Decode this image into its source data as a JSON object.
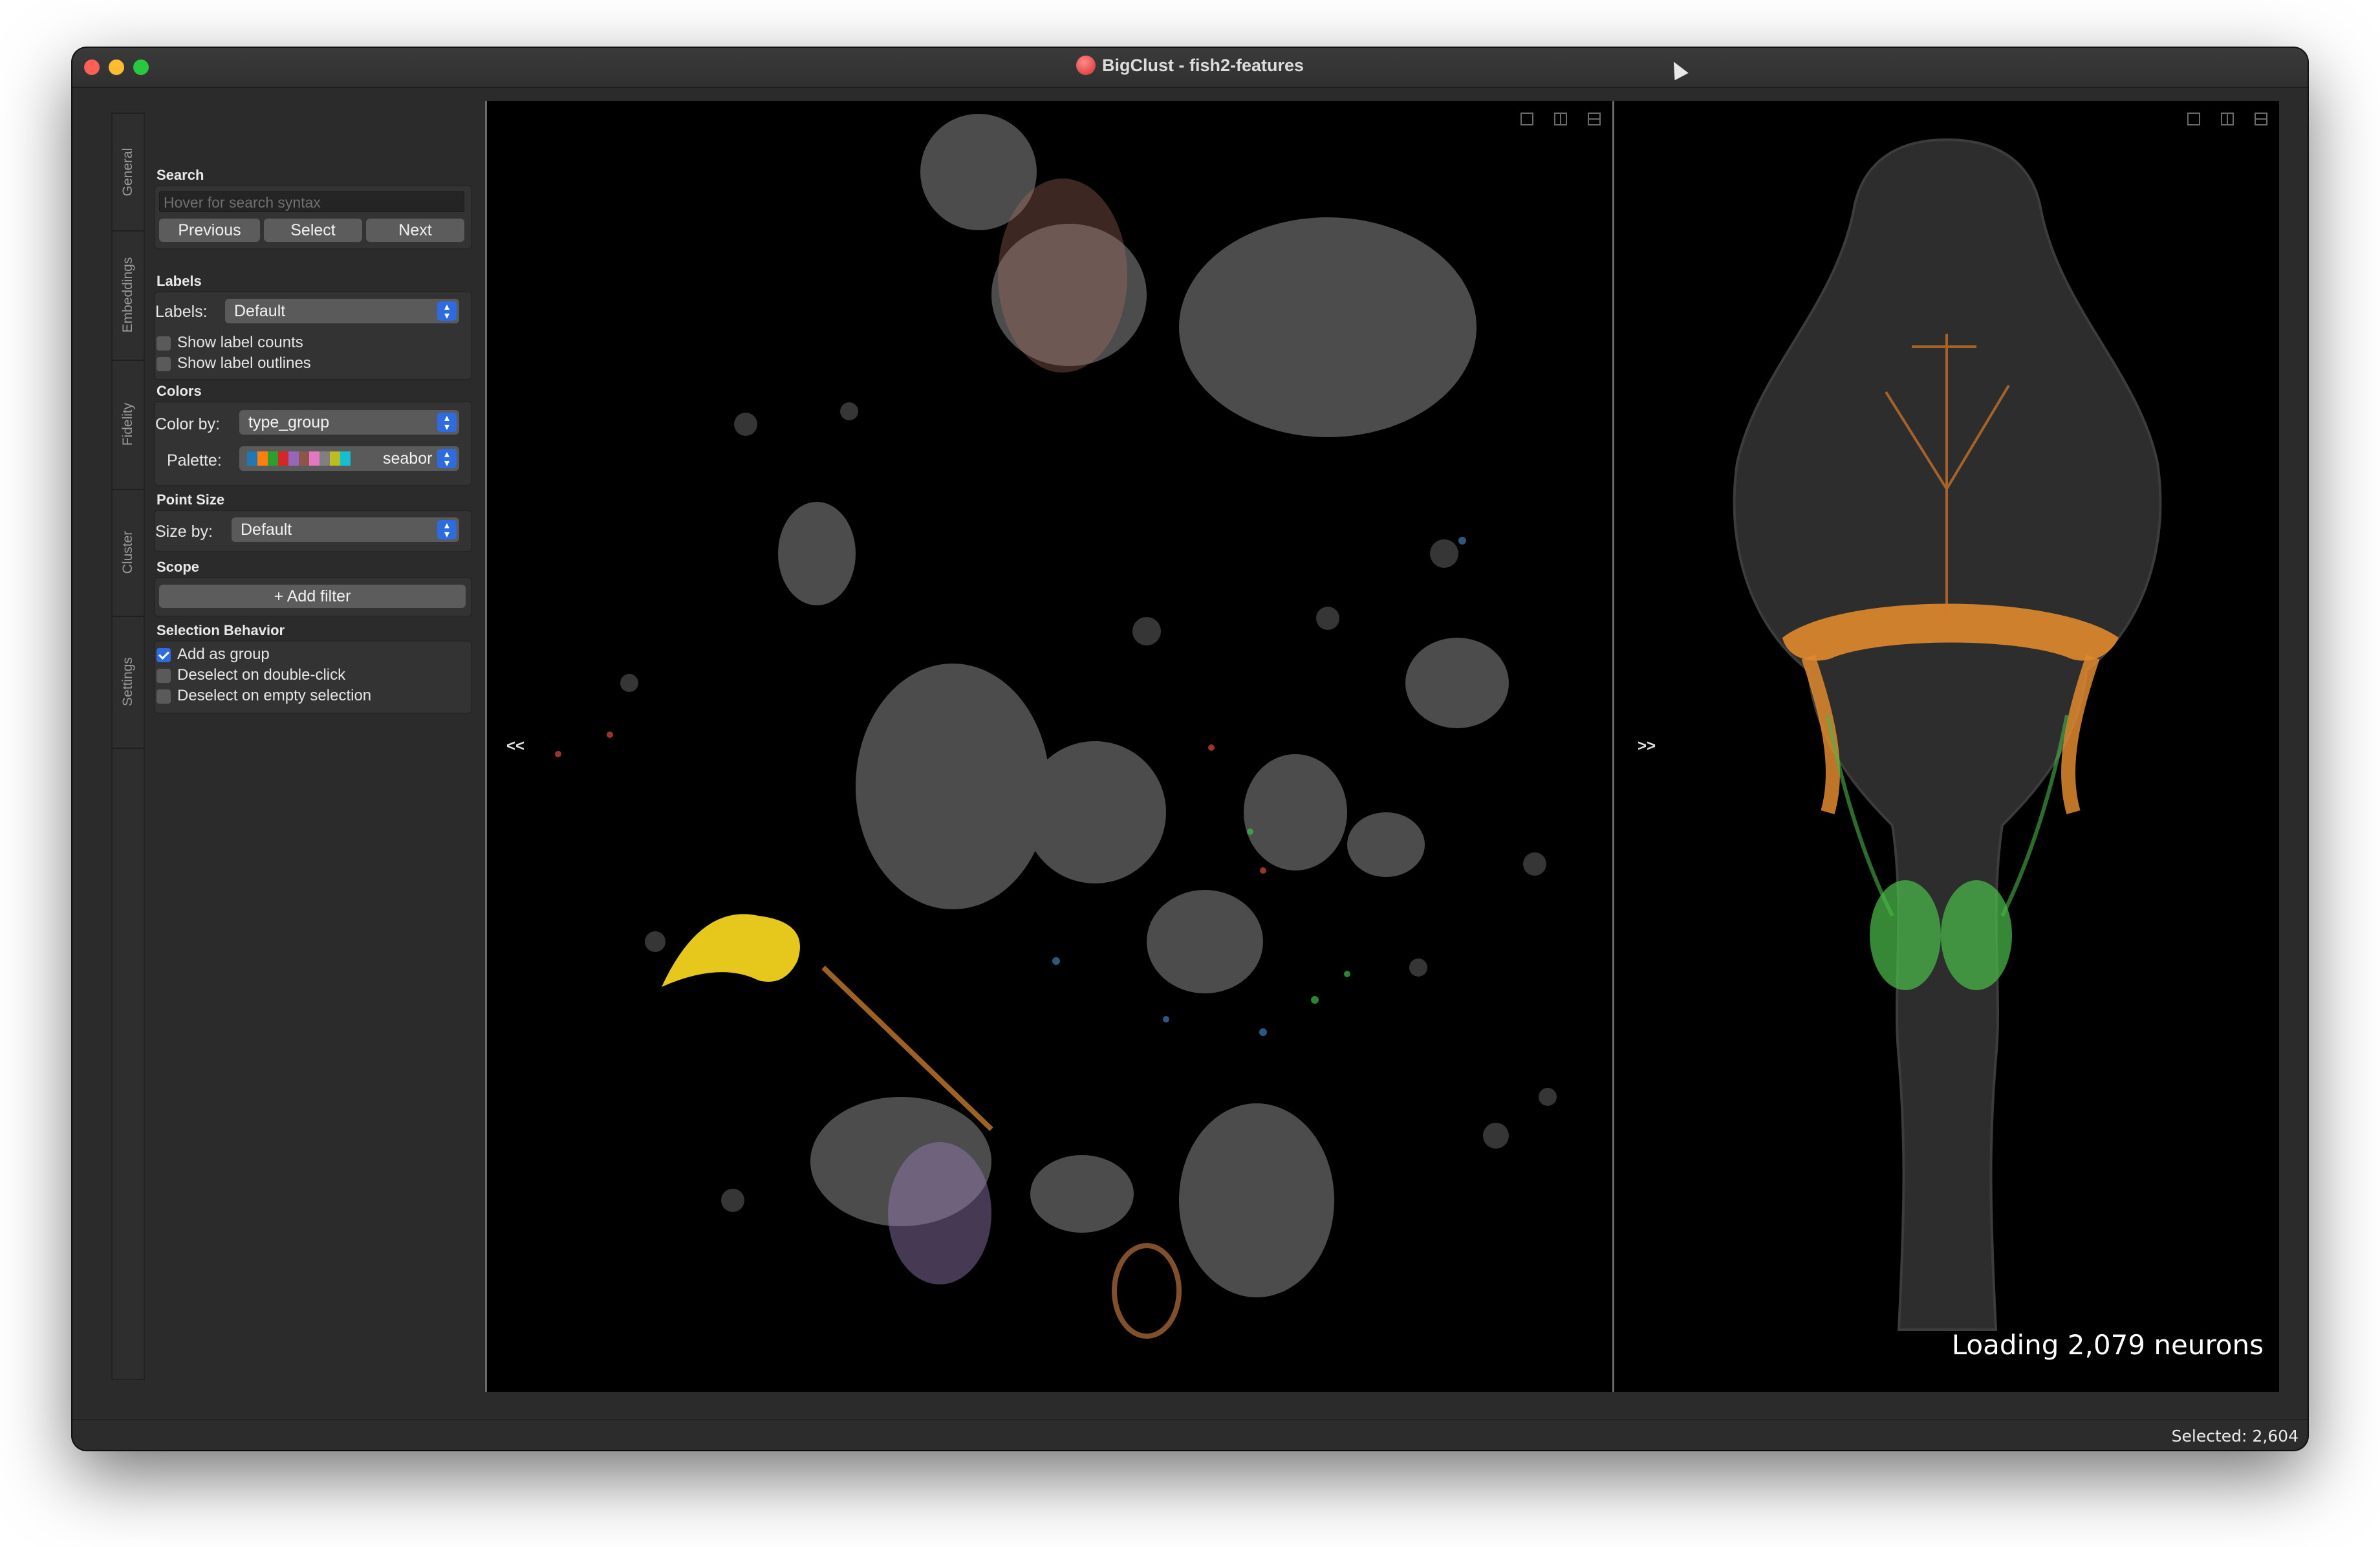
{
  "window": {
    "title": "BigClust - fish2-features"
  },
  "sidebar": {
    "tabs": [
      "General",
      "Embeddings",
      "Fidelity",
      "Cluster",
      "Settings"
    ]
  },
  "search": {
    "section_title": "Search",
    "placeholder": "Hover for search syntax",
    "previous_label": "Previous",
    "select_label": "Select",
    "next_label": "Next"
  },
  "labels": {
    "section_title": "Labels",
    "labels_label": "Labels:",
    "labels_value": "Default",
    "show_label_counts": "Show label counts",
    "show_label_counts_checked": false,
    "show_label_outlines": "Show label outlines",
    "show_label_outlines_checked": false
  },
  "colors": {
    "section_title": "Colors",
    "color_by_label": "Color by:",
    "color_by_value": "type_group",
    "palette_label": "Palette:",
    "palette_value": "seabor",
    "palette_swatches": [
      "#1f77b4",
      "#ff7f0e",
      "#2ca02c",
      "#d62728",
      "#9467bd",
      "#8c564b",
      "#e377c2",
      "#7f7f7f",
      "#bcbd22",
      "#17becf"
    ]
  },
  "point_size": {
    "section_title": "Point Size",
    "size_by_label": "Size by:",
    "size_by_value": "Default"
  },
  "scope": {
    "section_title": "Scope",
    "add_filter_label": "+ Add filter"
  },
  "selection_behavior": {
    "section_title": "Selection Behavior",
    "add_as_group": "Add as group",
    "add_as_group_checked": true,
    "deselect_double_click": "Deselect on double-click",
    "deselect_double_click_checked": false,
    "deselect_empty": "Deselect on empty selection",
    "deselect_empty_checked": false
  },
  "left_view": {
    "collapse_label": "<<"
  },
  "right_view": {
    "collapse_label": ">>",
    "loading_text": "Loading 2,079 neurons"
  },
  "statusbar": {
    "selected_text": "Selected: 2,604"
  }
}
